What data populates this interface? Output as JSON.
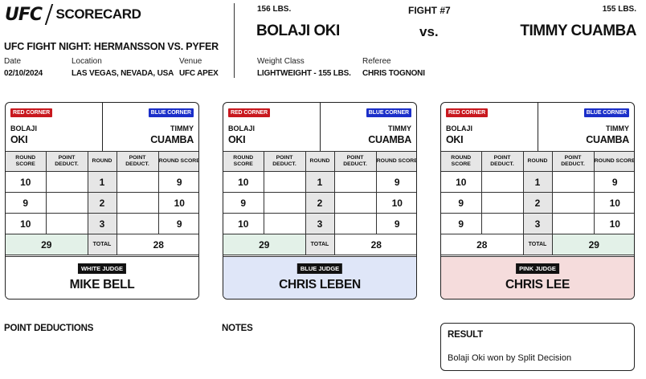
{
  "header": {
    "logo": "UFC",
    "title": "SCORECARD",
    "event": "UFC FIGHT NIGHT: HERMANSSON VS. PYFER",
    "date_label": "Date",
    "date": "02/10/2024",
    "location_label": "Location",
    "location": "LAS VEGAS, NEVADA, USA",
    "venue_label": "Venue",
    "venue": "UFC APEX"
  },
  "fight": {
    "number": "FIGHT #7",
    "vs": "vs.",
    "red_weight": "156 LBS.",
    "blue_weight": "155 LBS.",
    "red_name": "BOLAJI OKI",
    "blue_name": "TIMMY CUAMBA",
    "weight_class_label": "Weight Class",
    "weight_class": "LIGHTWEIGHT - 155 LBS.",
    "referee_label": "Referee",
    "referee": "CHRIS TOGNONI"
  },
  "card_labels": {
    "red_corner": "RED CORNER",
    "blue_corner": "BLUE CORNER",
    "red_first": "BOLAJI",
    "red_last": "OKI",
    "blue_first": "TIMMY",
    "blue_last": "CUAMBA",
    "round_score": "ROUND SCORE",
    "point_deduct": "POINT DEDUCT.",
    "round": "ROUND",
    "total": "TOTAL"
  },
  "cards": [
    {
      "judge_tag": "WHITE JUDGE",
      "judge_name": "MIKE BELL",
      "rounds": [
        {
          "round": "1",
          "red": "10",
          "blue": "9"
        },
        {
          "round": "2",
          "red": "9",
          "blue": "10"
        },
        {
          "round": "3",
          "red": "10",
          "blue": "9"
        }
      ],
      "red_total": "29",
      "blue_total": "28",
      "winner": "red",
      "judge_color": "#ffffff"
    },
    {
      "judge_tag": "BLUE JUDGE",
      "judge_name": "CHRIS LEBEN",
      "rounds": [
        {
          "round": "1",
          "red": "10",
          "blue": "9"
        },
        {
          "round": "2",
          "red": "9",
          "blue": "10"
        },
        {
          "round": "3",
          "red": "10",
          "blue": "9"
        }
      ],
      "red_total": "29",
      "blue_total": "28",
      "winner": "red",
      "judge_color": "#dfe6f8"
    },
    {
      "judge_tag": "PINK JUDGE",
      "judge_name": "CHRIS LEE",
      "rounds": [
        {
          "round": "1",
          "red": "10",
          "blue": "9"
        },
        {
          "round": "2",
          "red": "9",
          "blue": "10"
        },
        {
          "round": "3",
          "red": "9",
          "blue": "10"
        }
      ],
      "red_total": "28",
      "blue_total": "29",
      "winner": "blue",
      "judge_color": "#f5dcdc"
    }
  ],
  "footer": {
    "deductions_label": "POINT DEDUCTIONS",
    "notes_label": "NOTES",
    "result_label": "RESULT",
    "result_text": "Bolaji Oki won by Split Decision"
  },
  "colors": {
    "red_corner": "#c8181e",
    "blue_corner": "#1b2fc9",
    "winner_fill": "#e3f1e8",
    "header_fill": "#e6e6e6"
  }
}
